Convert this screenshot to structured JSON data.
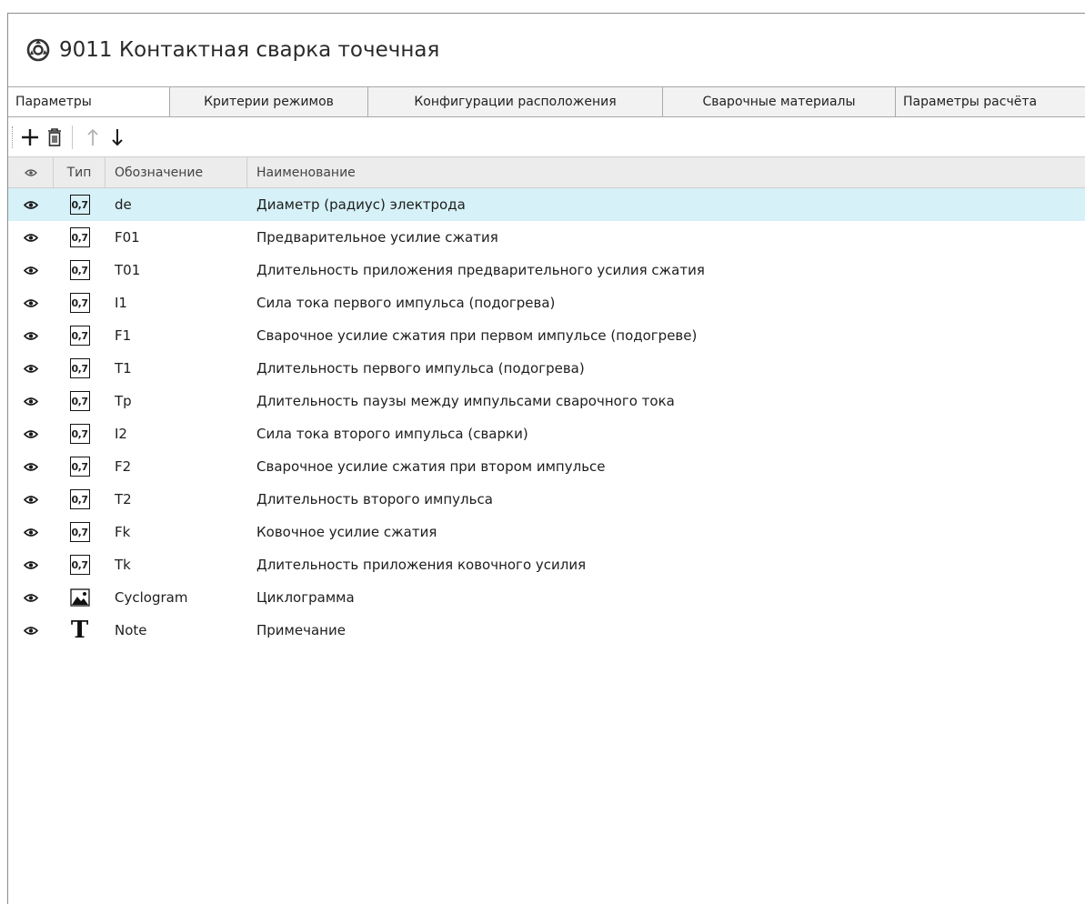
{
  "title": {
    "icon": "object-settings-icon",
    "text": "9011 Контактная сварка точечная"
  },
  "tabs": [
    {
      "label": "Параметры",
      "active": true
    },
    {
      "label": "Критерии режимов",
      "active": false
    },
    {
      "label": "Конфигурации расположения",
      "active": false
    },
    {
      "label": "Сварочные материалы",
      "active": false
    },
    {
      "label": "Параметры расчёта",
      "active": false
    }
  ],
  "toolbar": {
    "add": "plus-icon",
    "delete": "trash-icon",
    "move_up": "arrow-up-icon",
    "move_down": "arrow-down-icon"
  },
  "columns": {
    "visibility": "eye-icon",
    "type": "Тип",
    "code": "Обозначение",
    "name": "Наименование"
  },
  "numeric_badge": "0,7",
  "text_type_glyph": "T",
  "rows": [
    {
      "type": "numeric",
      "code": "de",
      "name": "Диаметр (радиус) электрода",
      "selected": true
    },
    {
      "type": "numeric",
      "code": "F01",
      "name": "Предварительное усилие сжатия",
      "selected": false
    },
    {
      "type": "numeric",
      "code": "T01",
      "name": "Длительность приложения предварительного усилия сжатия",
      "selected": false
    },
    {
      "type": "numeric",
      "code": "I1",
      "name": "Сила тока первого импульса (подогрева)",
      "selected": false
    },
    {
      "type": "numeric",
      "code": "F1",
      "name": "Сварочное усилие сжатия при первом импульсе (подогреве)",
      "selected": false
    },
    {
      "type": "numeric",
      "code": "T1",
      "name": "Длительность первого импульса  (подогрева)",
      "selected": false
    },
    {
      "type": "numeric",
      "code": "Tp",
      "name": "Длительность паузы между импульсами сварочного тока",
      "selected": false
    },
    {
      "type": "numeric",
      "code": "I2",
      "name": "Сила тока второго импульса (сварки)",
      "selected": false
    },
    {
      "type": "numeric",
      "code": "F2",
      "name": "Сварочное усилие сжатия при втором импульсе",
      "selected": false
    },
    {
      "type": "numeric",
      "code": "T2",
      "name": "Длительность второго импульса",
      "selected": false
    },
    {
      "type": "numeric",
      "code": "Fk",
      "name": "Ковочное усилие сжатия",
      "selected": false
    },
    {
      "type": "numeric",
      "code": "Tk",
      "name": "Длительность приложения ковочного усилия",
      "selected": false
    },
    {
      "type": "image",
      "code": "Cyclogram",
      "name": "Циклограмма",
      "selected": false
    },
    {
      "type": "text",
      "code": "Note",
      "name": "Примечание",
      "selected": false
    }
  ],
  "colors": {
    "selected_row": "#d6f1f7",
    "header_bg": "#ececec"
  }
}
